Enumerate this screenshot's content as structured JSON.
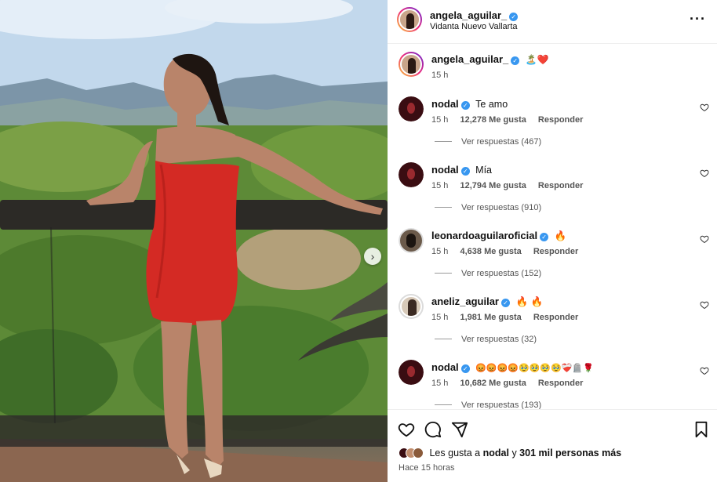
{
  "post": {
    "author": "angela_aguilar_",
    "location": "Vidanta Nuevo Vallarta",
    "caption_emoji": "🏝️❤️",
    "caption_time": "15 h",
    "more_icon": "more-dots-icon"
  },
  "comments": [
    {
      "user": "nodal",
      "text": "Te amo",
      "time": "15 h",
      "likes": "12,278 Me gusta",
      "reply": "Responder",
      "view_replies": "Ver respuestas (467)"
    },
    {
      "user": "nodal",
      "text": "Mía",
      "time": "15 h",
      "likes": "12,794 Me gusta",
      "reply": "Responder",
      "view_replies": "Ver respuestas (910)"
    },
    {
      "user": "leonardoaguilaroficial",
      "text": "🔥",
      "time": "15 h",
      "likes": "4,638 Me gusta",
      "reply": "Responder",
      "view_replies": "Ver respuestas (152)"
    },
    {
      "user": "aneliz_aguilar",
      "text": "🔥 🔥",
      "time": "15 h",
      "likes": "1,981 Me gusta",
      "reply": "Responder",
      "view_replies": "Ver respuestas (32)"
    },
    {
      "user": "nodal",
      "text": "😡😡😡😡🥹🥹🥹🥹❤️‍🩹🪦🌹",
      "time": "15 h",
      "likes": "10,682 Me gusta",
      "reply": "Responder",
      "view_replies": "Ver respuestas (193)"
    }
  ],
  "footer": {
    "likes_prefix": "Les gusta a",
    "likes_user": "nodal",
    "likes_connector": "y",
    "likes_count": "301 mil personas más",
    "posted_ago": "Hace 15 horas"
  },
  "colors": {
    "verified": "#3897f0",
    "dress": "#d42a24",
    "accent": "#111111"
  }
}
